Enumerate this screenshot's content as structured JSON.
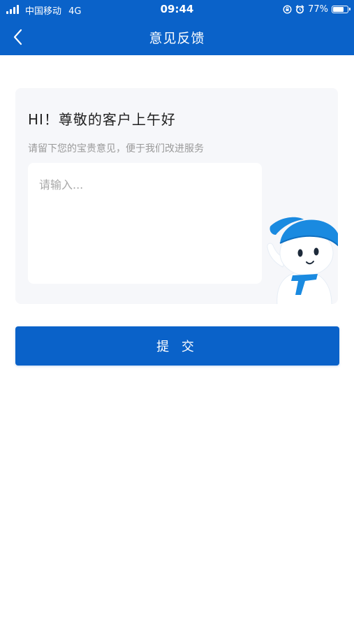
{
  "status_bar": {
    "carrier": "中国移动",
    "network": "4G",
    "time": "09:44",
    "battery": "77%",
    "battery_level": 0.77
  },
  "nav": {
    "title": "意见反馈",
    "back_icon": "chevron-left-icon"
  },
  "feedback": {
    "greeting": "HI！尊敬的客户上午好",
    "subtitle": "请留下您的宝贵意见，便于我们改进服务",
    "placeholder": "请输入...",
    "value": ""
  },
  "submit_label": "提 交",
  "colors": {
    "brand": "#0a62c9",
    "card_background": "#f6f7fa"
  }
}
